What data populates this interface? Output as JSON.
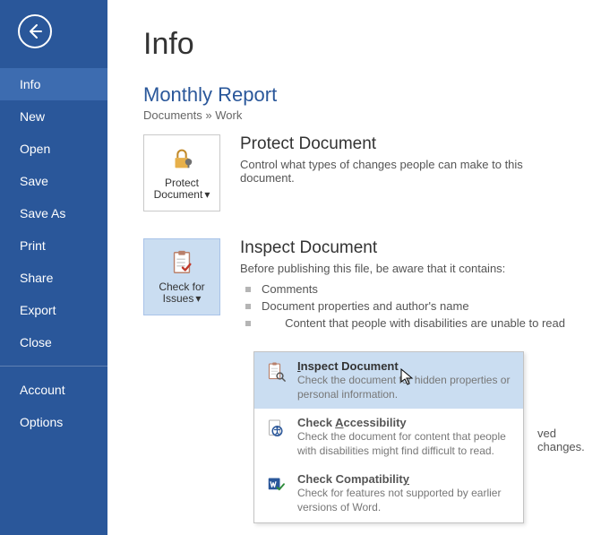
{
  "nav": {
    "items": [
      {
        "label": "Info",
        "active": true
      },
      {
        "label": "New"
      },
      {
        "label": "Open"
      },
      {
        "label": "Save"
      },
      {
        "label": "Save As"
      },
      {
        "label": "Print"
      },
      {
        "label": "Share"
      },
      {
        "label": "Export"
      },
      {
        "label": "Close"
      }
    ],
    "footer": [
      {
        "label": "Account"
      },
      {
        "label": "Options"
      }
    ]
  },
  "page": {
    "title": "Info",
    "doc_title": "Monthly Report",
    "crumb_left": "Documents",
    "crumb_sep": " » ",
    "crumb_right": "Work"
  },
  "protect": {
    "button_label": "Protect Document",
    "heading": "Protect Document",
    "desc": "Control what types of changes people can make to this document."
  },
  "issues": {
    "button_label": "Check for Issues",
    "heading": "Inspect Document",
    "desc": "Before publishing this file, be aware that it contains:",
    "bullets": [
      "Comments",
      "Document properties and author's name",
      "Content that people with disabilities are unable to read"
    ],
    "partial_line": "ved changes."
  },
  "menu": {
    "items": [
      {
        "title_pre": "",
        "title_accel": "I",
        "title_post": "nspect Document",
        "sub": "Check the document for hidden properties or personal information.",
        "hl": true
      },
      {
        "title_pre": "Check ",
        "title_accel": "A",
        "title_post": "ccessibility",
        "sub": "Check the document for content that people with disabilities might find difficult to read."
      },
      {
        "title_pre": "Check Compatibilit",
        "title_accel": "y",
        "title_post": "",
        "sub": "Check for features not supported by earlier versions of Word."
      }
    ]
  }
}
